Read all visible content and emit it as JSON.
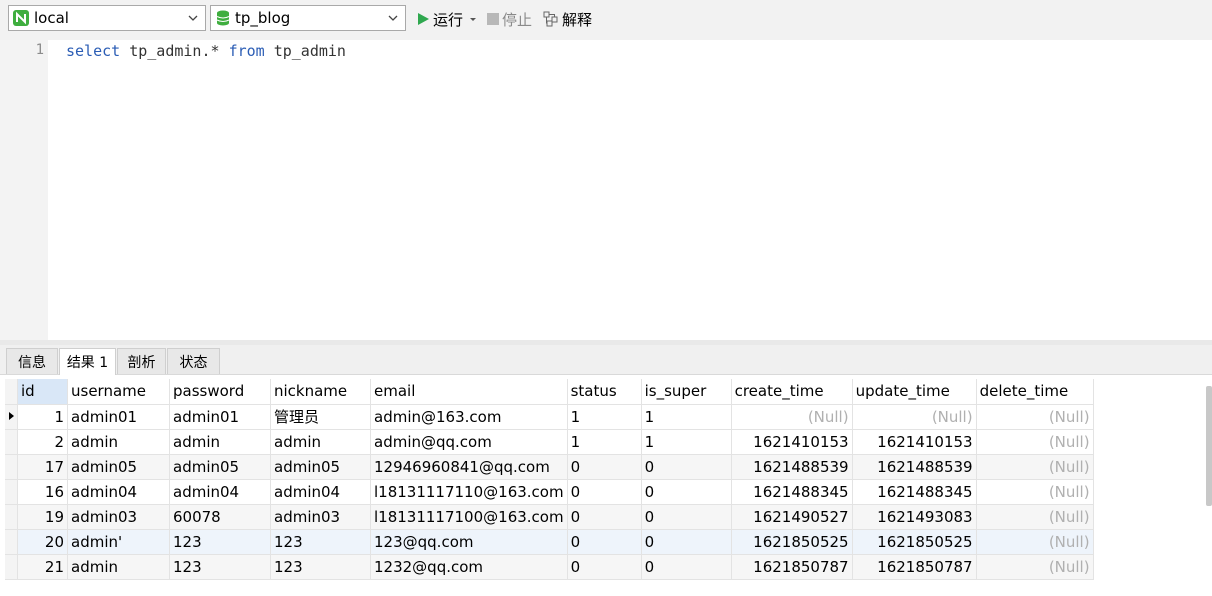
{
  "toolbar": {
    "connection": "local",
    "database": "tp_blog",
    "run_label": "运行",
    "stop_label": "停止",
    "explain_label": "解释"
  },
  "editor": {
    "line_number": "1",
    "kw1": "select",
    "text1": " tp_admin.* ",
    "kw2": "from",
    "text2": " tp_admin"
  },
  "tabs": [
    "信息",
    "结果 1",
    "剖析",
    "状态"
  ],
  "grid": {
    "columns": [
      "id",
      "username",
      "password",
      "nickname",
      "email",
      "status",
      "is_super",
      "create_time",
      "update_time",
      "delete_time"
    ],
    "rows": [
      [
        "1",
        "admin01",
        "admin01",
        "管理员",
        "admin@163.com",
        "1",
        "1",
        "(Null)",
        "(Null)",
        "(Null)"
      ],
      [
        "2",
        "admin",
        "admin",
        "admin",
        "admin@qq.com",
        "1",
        "1",
        "1621410153",
        "1621410153",
        "(Null)"
      ],
      [
        "17",
        "admin05",
        "admin05",
        "admin05",
        "12946960841@qq.com",
        "0",
        "0",
        "1621488539",
        "1621488539",
        "(Null)"
      ],
      [
        "16",
        "admin04",
        "admin04",
        "admin04",
        "l18131117110@163.com",
        "0",
        "0",
        "1621488345",
        "1621488345",
        "(Null)"
      ],
      [
        "19",
        "admin03",
        "60078",
        "admin03",
        "l18131117100@163.com",
        "0",
        "0",
        "1621490527",
        "1621493083",
        "(Null)"
      ],
      [
        "20",
        "admin'",
        "123",
        "123",
        "123@qq.com",
        "0",
        "0",
        "1621850525",
        "1621850525",
        "(Null)"
      ],
      [
        "21",
        "admin",
        "123",
        "123",
        "1232@qq.com",
        "0",
        "0",
        "1621850787",
        "1621850787",
        "(Null)"
      ]
    ]
  }
}
